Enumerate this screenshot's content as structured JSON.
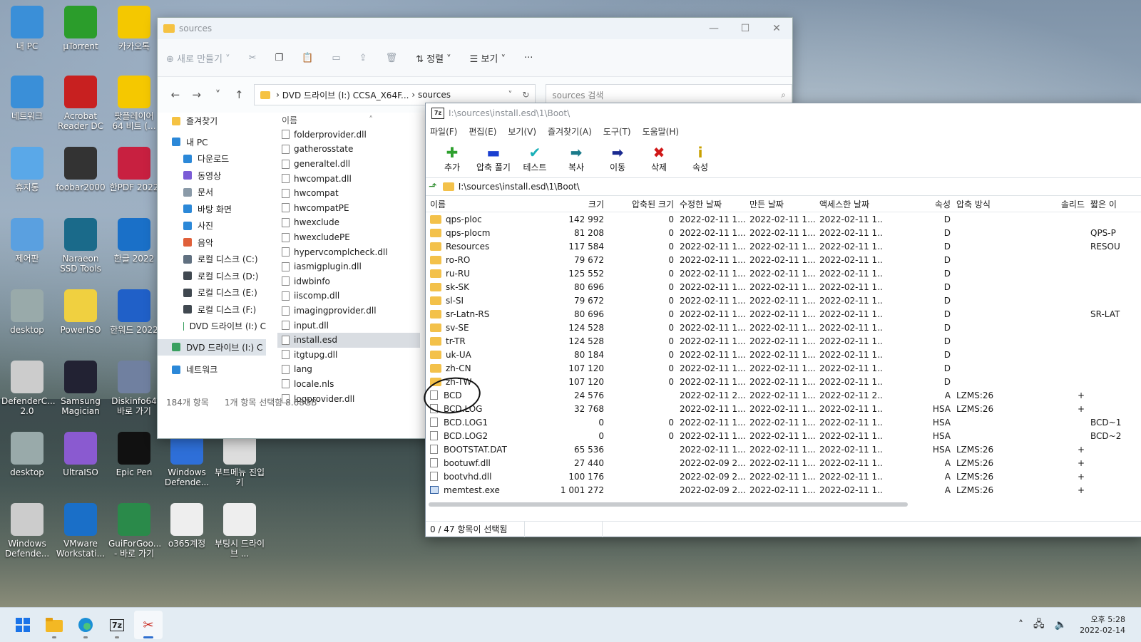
{
  "desktop": {
    "icons": [
      {
        "label": "내 PC",
        "x": "c1",
        "glyph": "🖥"
      },
      {
        "label": "µTorrent"
      },
      {
        "label": "카카오톡"
      },
      {
        "label": "네트워크"
      },
      {
        "label": "Acrobat Reader DC"
      },
      {
        "label": "팟플레이어 64 비트 (..."
      },
      {
        "label": "휴지통"
      },
      {
        "label": "foobar2000"
      },
      {
        "label": "한PDF 2022"
      },
      {
        "label": "제어판"
      },
      {
        "label": "Naraeon SSD Tools"
      },
      {
        "label": "한글 2022"
      },
      {
        "label": "desktop"
      },
      {
        "label": "PowerISO"
      },
      {
        "label": "한워드 2022"
      },
      {
        "label": "DefenderC... 2.0"
      },
      {
        "label": "Samsung Magician"
      },
      {
        "label": "Diskinfo64 바로 가기"
      },
      {
        "label": "desktop"
      },
      {
        "label": "UltraISO"
      },
      {
        "label": "Epic Pen"
      },
      {
        "label": "Windows Defende..."
      },
      {
        "label": "부트메뉴 진입키"
      },
      {
        "label": "Windows Defende..."
      },
      {
        "label": "VMware Workstati..."
      },
      {
        "label": "GuiForGoo... - 바로 가기"
      },
      {
        "label": "o365계정"
      },
      {
        "label": "부팅시 드라이브 ..."
      }
    ]
  },
  "explorer": {
    "title": "sources",
    "toolbar": {
      "new": "새로 만들기",
      "sort": "정렬",
      "view": "보기",
      "more": "···"
    },
    "address": {
      "drive": "DVD 드라이브 (I:) CCSA_X64F...",
      "folder": "sources"
    },
    "search_placeholder": "sources 검색",
    "nav": [
      {
        "label": "즐겨찾기",
        "color": "#f5c242"
      },
      {
        "label": "내 PC",
        "color": "#2b88d8"
      },
      {
        "label": "다운로드",
        "color": "#2b88d8"
      },
      {
        "label": "동영상",
        "color": "#7b5cd6"
      },
      {
        "label": "문서",
        "color": "#8a9aa8"
      },
      {
        "label": "바탕 화면",
        "color": "#2b88d8"
      },
      {
        "label": "사진",
        "color": "#2b88d8"
      },
      {
        "label": "음악",
        "color": "#e0603a"
      },
      {
        "label": "로컬 디스크 (C:)",
        "color": "#607080"
      },
      {
        "label": "로컬 디스크 (D:)",
        "color": "#404850"
      },
      {
        "label": "로컬 디스크 (E:)",
        "color": "#404850"
      },
      {
        "label": "로컬 디스크 (F:)",
        "color": "#404850"
      },
      {
        "label": "DVD 드라이브 (I:) C",
        "color": "#3aa060"
      },
      {
        "label": "DVD 드라이브 (I:) C",
        "color": "#3aa060"
      },
      {
        "label": "네트워크",
        "color": "#2b88d8"
      }
    ],
    "column_name": "이름",
    "files": [
      "folderprovider.dll",
      "gatherosstate",
      "generaltel.dll",
      "hwcompat.dll",
      "hwcompat",
      "hwcompatPE",
      "hwexclude",
      "hwexcludePE",
      "hypervcomplcheck.dll",
      "iasmigplugin.dll",
      "idwbinfo",
      "iiscomp.dll",
      "imagingprovider.dll",
      "input.dll",
      "install.esd",
      "itgtupg.dll",
      "lang",
      "locale.nls",
      "logprovider.dll"
    ],
    "selected_file": "install.esd",
    "status_count": "184개 항목",
    "status_selected": "1개 항목 선택함 8.68GB"
  },
  "sevenzip": {
    "title": "I:\\sources\\install.esd\\1\\Boot\\",
    "menu": [
      "파일(F)",
      "편집(E)",
      "보기(V)",
      "즐겨찾기(A)",
      "도구(T)",
      "도움말(H)"
    ],
    "tools": [
      {
        "label": "추가",
        "glyph": "✚",
        "color": "#2ea02e"
      },
      {
        "label": "압축 풀기",
        "glyph": "▬",
        "color": "#1a3fd0"
      },
      {
        "label": "테스트",
        "glyph": "✔",
        "color": "#1ab0b8"
      },
      {
        "label": "복사",
        "glyph": "➡",
        "color": "#1a7a8a"
      },
      {
        "label": "이동",
        "glyph": "➡",
        "color": "#1a2a90"
      },
      {
        "label": "삭제",
        "glyph": "✖",
        "color": "#d01818"
      },
      {
        "label": "속성",
        "glyph": "i",
        "color": "#c8a000"
      }
    ],
    "path": "I:\\sources\\install.esd\\1\\Boot\\",
    "columns": [
      "이름",
      "크기",
      "압축된 크기",
      "수정한 날짜",
      "만든 날짜",
      "액세스한 날짜",
      "속성",
      "압축 방식",
      "솔리드",
      "짧은 이"
    ],
    "rows": [
      {
        "name": "qps-ploc",
        "type": "folder",
        "size": "142 992",
        "packed": "0",
        "mod": "2022-02-11 1...",
        "cre": "2022-02-11 1...",
        "acc": "2022-02-11 1...",
        "attr": "D",
        "method": "",
        "solid": "",
        "short": ""
      },
      {
        "name": "qps-plocm",
        "type": "folder",
        "size": "81 208",
        "packed": "0",
        "mod": "2022-02-11 1...",
        "cre": "2022-02-11 1...",
        "acc": "2022-02-11 1...",
        "attr": "D",
        "method": "",
        "solid": "",
        "short": "QPS-P"
      },
      {
        "name": "Resources",
        "type": "folder",
        "size": "117 584",
        "packed": "0",
        "mod": "2022-02-11 1...",
        "cre": "2022-02-11 1...",
        "acc": "2022-02-11 1...",
        "attr": "D",
        "method": "",
        "solid": "",
        "short": "RESOU"
      },
      {
        "name": "ro-RO",
        "type": "folder",
        "size": "79 672",
        "packed": "0",
        "mod": "2022-02-11 1...",
        "cre": "2022-02-11 1...",
        "acc": "2022-02-11 1...",
        "attr": "D",
        "method": "",
        "solid": "",
        "short": ""
      },
      {
        "name": "ru-RU",
        "type": "folder",
        "size": "125 552",
        "packed": "0",
        "mod": "2022-02-11 1...",
        "cre": "2022-02-11 1...",
        "acc": "2022-02-11 1...",
        "attr": "D",
        "method": "",
        "solid": "",
        "short": ""
      },
      {
        "name": "sk-SK",
        "type": "folder",
        "size": "80 696",
        "packed": "0",
        "mod": "2022-02-11 1...",
        "cre": "2022-02-11 1...",
        "acc": "2022-02-11 1...",
        "attr": "D",
        "method": "",
        "solid": "",
        "short": ""
      },
      {
        "name": "sl-SI",
        "type": "folder",
        "size": "79 672",
        "packed": "0",
        "mod": "2022-02-11 1...",
        "cre": "2022-02-11 1...",
        "acc": "2022-02-11 1...",
        "attr": "D",
        "method": "",
        "solid": "",
        "short": ""
      },
      {
        "name": "sr-Latn-RS",
        "type": "folder",
        "size": "80 696",
        "packed": "0",
        "mod": "2022-02-11 1...",
        "cre": "2022-02-11 1...",
        "acc": "2022-02-11 1...",
        "attr": "D",
        "method": "",
        "solid": "",
        "short": "SR-LAT"
      },
      {
        "name": "sv-SE",
        "type": "folder",
        "size": "124 528",
        "packed": "0",
        "mod": "2022-02-11 1...",
        "cre": "2022-02-11 1...",
        "acc": "2022-02-11 1...",
        "attr": "D",
        "method": "",
        "solid": "",
        "short": ""
      },
      {
        "name": "tr-TR",
        "type": "folder",
        "size": "124 528",
        "packed": "0",
        "mod": "2022-02-11 1...",
        "cre": "2022-02-11 1...",
        "acc": "2022-02-11 1...",
        "attr": "D",
        "method": "",
        "solid": "",
        "short": ""
      },
      {
        "name": "uk-UA",
        "type": "folder",
        "size": "80 184",
        "packed": "0",
        "mod": "2022-02-11 1...",
        "cre": "2022-02-11 1...",
        "acc": "2022-02-11 1...",
        "attr": "D",
        "method": "",
        "solid": "",
        "short": ""
      },
      {
        "name": "zh-CN",
        "type": "folder",
        "size": "107 120",
        "packed": "0",
        "mod": "2022-02-11 1...",
        "cre": "2022-02-11 1...",
        "acc": "2022-02-11 1...",
        "attr": "D",
        "method": "",
        "solid": "",
        "short": ""
      },
      {
        "name": "zh-TW",
        "type": "folder",
        "size": "107 120",
        "packed": "0",
        "mod": "2022-02-11 1...",
        "cre": "2022-02-11 1...",
        "acc": "2022-02-11 1...",
        "attr": "D",
        "method": "",
        "solid": "",
        "short": ""
      },
      {
        "name": "BCD",
        "type": "file",
        "size": "24 576",
        "packed": "",
        "mod": "2022-02-11 2...",
        "cre": "2022-02-11 1...",
        "acc": "2022-02-11 2...",
        "attr": "A",
        "method": "LZMS:26",
        "solid": "+",
        "short": ""
      },
      {
        "name": "BCD.LOG",
        "type": "file",
        "size": "32 768",
        "packed": "",
        "mod": "2022-02-11 1...",
        "cre": "2022-02-11 1...",
        "acc": "2022-02-11 1...",
        "attr": "HSA",
        "method": "LZMS:26",
        "solid": "+",
        "short": ""
      },
      {
        "name": "BCD.LOG1",
        "type": "file",
        "size": "0",
        "packed": "0",
        "mod": "2022-02-11 1...",
        "cre": "2022-02-11 1...",
        "acc": "2022-02-11 1...",
        "attr": "HSA",
        "method": "",
        "solid": "",
        "short": "BCD~1"
      },
      {
        "name": "BCD.LOG2",
        "type": "file",
        "size": "0",
        "packed": "0",
        "mod": "2022-02-11 1...",
        "cre": "2022-02-11 1...",
        "acc": "2022-02-11 1...",
        "attr": "HSA",
        "method": "",
        "solid": "",
        "short": "BCD~2"
      },
      {
        "name": "BOOTSTAT.DAT",
        "type": "file",
        "size": "65 536",
        "packed": "",
        "mod": "2022-02-11 1...",
        "cre": "2022-02-11 1...",
        "acc": "2022-02-11 1...",
        "attr": "HSA",
        "method": "LZMS:26",
        "solid": "+",
        "short": ""
      },
      {
        "name": "bootuwf.dll",
        "type": "file",
        "size": "27 440",
        "packed": "",
        "mod": "2022-02-09 2...",
        "cre": "2022-02-11 1...",
        "acc": "2022-02-11 1...",
        "attr": "A",
        "method": "LZMS:26",
        "solid": "+",
        "short": ""
      },
      {
        "name": "bootvhd.dll",
        "type": "file",
        "size": "100 176",
        "packed": "",
        "mod": "2022-02-09 2...",
        "cre": "2022-02-11 1...",
        "acc": "2022-02-11 1...",
        "attr": "A",
        "method": "LZMS:26",
        "solid": "+",
        "short": ""
      },
      {
        "name": "memtest.exe",
        "type": "exe",
        "size": "1 001 272",
        "packed": "",
        "mod": "2022-02-09 2...",
        "cre": "2022-02-11 1...",
        "acc": "2022-02-11 1...",
        "attr": "A",
        "method": "LZMS:26",
        "solid": "+",
        "short": ""
      }
    ],
    "status": "0 / 47 항목이 선택됨"
  },
  "taskbar": {
    "apps": [
      "start-icon",
      "file-explorer-icon",
      "edge-icon",
      "7zip-icon",
      "snipping-tool-icon"
    ],
    "time": "오후 5:28",
    "date": "2022-02-14"
  }
}
